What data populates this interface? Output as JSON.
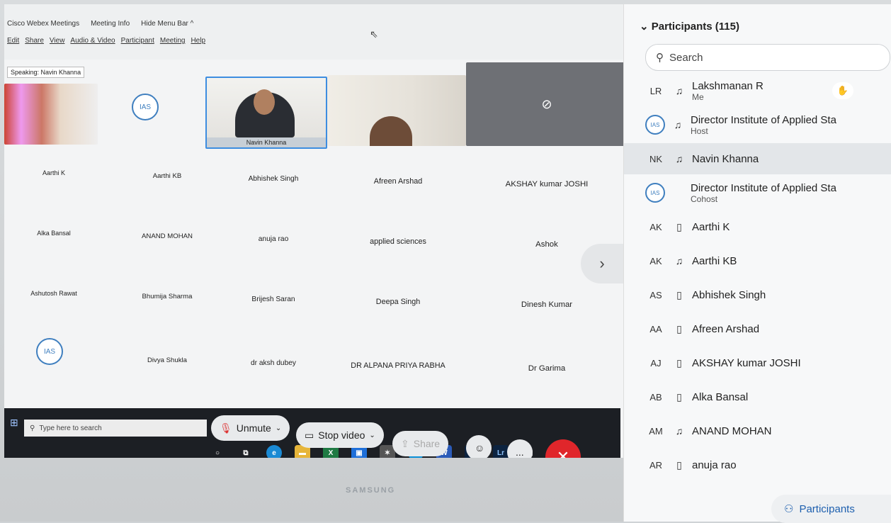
{
  "app": {
    "title": "Cisco Webex Meetings",
    "meeting_info": "Meeting Info",
    "hide_menu": "Hide Menu Bar ^"
  },
  "menu": [
    "Edit",
    "Share",
    "View",
    "Audio & Video",
    "Participant",
    "Meeting",
    "Help"
  ],
  "speaking": "Speaking: Navin Khanna",
  "videos": {
    "active_name": "Navin Khanna"
  },
  "grid_names": [
    "Aarthi K",
    "Aarthi KB",
    "Abhishek Singh",
    "Afreen Arshad",
    "AKSHAY kumar JOSHI",
    "Alka Bansal",
    "ANAND MOHAN",
    "anuja rao",
    "applied sciences",
    "Ashok",
    "Ashutosh Rawat",
    "Bhumija Sharma",
    "Brijesh Saran",
    "Deepa Singh",
    "Dinesh Kumar",
    "",
    "Divya Shukla",
    "dr aksh dubey",
    "DR ALPANA PRIYA RABHA",
    "Dr Garima"
  ],
  "controls": {
    "unmute": "Unmute",
    "stop_video": "Stop video",
    "share": "Share",
    "more": "...",
    "end": "✕"
  },
  "taskbar": {
    "search_placeholder": "Type here to search",
    "brand": "SAMSUNG"
  },
  "panel": {
    "title": "Participants (115)",
    "search_placeholder": "Search",
    "bottom_button": "Participants",
    "participants": [
      {
        "initials": "LR",
        "name": "Lakshmanan R",
        "role": "Me",
        "icon": "headset"
      },
      {
        "initials": "",
        "name": "Director Institute of Applied Sta",
        "role": "Host",
        "icon": "headset"
      },
      {
        "initials": "NK",
        "name": "Navin Khanna",
        "role": "",
        "icon": "headset"
      },
      {
        "initials": "",
        "name": "Director Institute of Applied Sta",
        "role": "Cohost",
        "icon": ""
      },
      {
        "initials": "AK",
        "name": "Aarthi K",
        "role": "",
        "icon": "phone"
      },
      {
        "initials": "AK",
        "name": "Aarthi KB",
        "role": "",
        "icon": "headset"
      },
      {
        "initials": "AS",
        "name": "Abhishek Singh",
        "role": "",
        "icon": "phone"
      },
      {
        "initials": "AA",
        "name": "Afreen Arshad",
        "role": "",
        "icon": "phone"
      },
      {
        "initials": "AJ",
        "name": "AKSHAY kumar JOSHI",
        "role": "",
        "icon": "phone"
      },
      {
        "initials": "AB",
        "name": "Alka Bansal",
        "role": "",
        "icon": "phone"
      },
      {
        "initials": "AM",
        "name": "ANAND MOHAN",
        "role": "",
        "icon": "headset"
      },
      {
        "initials": "AR",
        "name": "anuja rao",
        "role": "",
        "icon": "phone"
      }
    ]
  }
}
